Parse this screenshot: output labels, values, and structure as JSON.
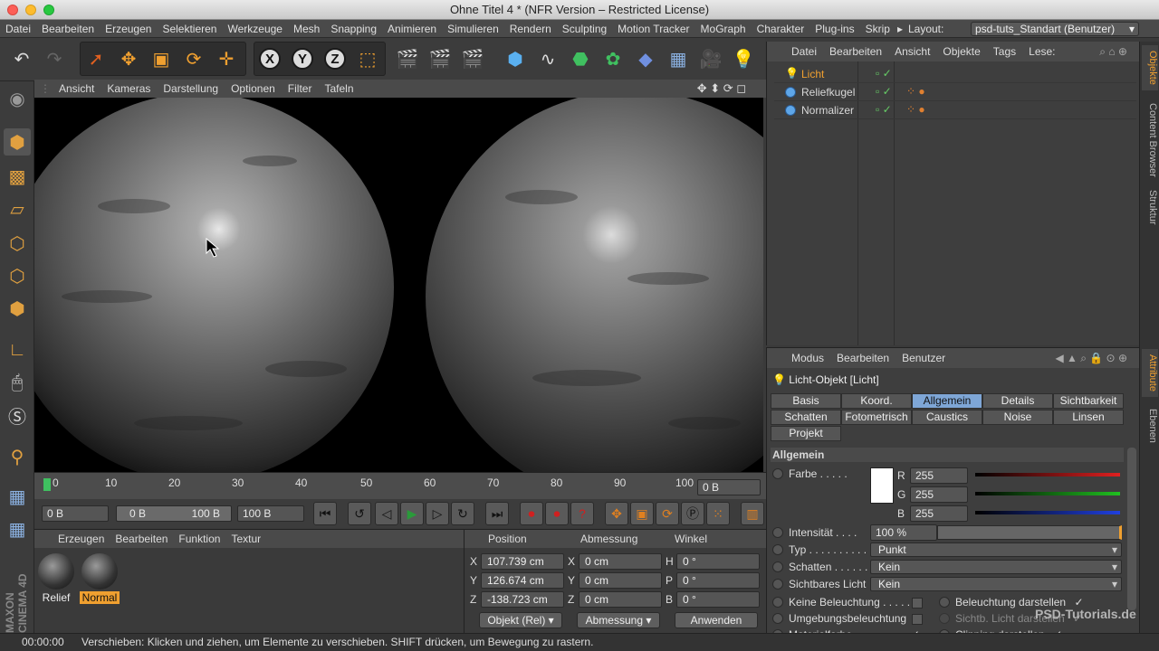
{
  "window": {
    "title": "Ohne Titel 4 * (NFR Version – Restricted License)"
  },
  "menubar": {
    "items": [
      "Datei",
      "Bearbeiten",
      "Erzeugen",
      "Selektieren",
      "Werkzeuge",
      "Mesh",
      "Snapping",
      "Animieren",
      "Simulieren",
      "Rendern",
      "Sculpting",
      "Motion Tracker",
      "MoGraph",
      "Charakter",
      "Plug-ins",
      "Skrip"
    ],
    "layout_label": "Layout:",
    "layout_value": "psd-tuts_Standart (Benutzer)"
  },
  "viewport": {
    "menu": [
      "Ansicht",
      "Kameras",
      "Darstellung",
      "Optionen",
      "Filter",
      "Tafeln"
    ]
  },
  "timeline": {
    "ticks": [
      "0",
      "10",
      "20",
      "30",
      "40",
      "50",
      "60",
      "70",
      "80",
      "90",
      "100"
    ],
    "current_frame_field": "0 B",
    "start_field": "0 B",
    "range_min": "0 B",
    "range_max": "100 B",
    "end_field": "100 B"
  },
  "material_manager": {
    "menu": [
      "Erzeugen",
      "Bearbeiten",
      "Funktion",
      "Textur"
    ],
    "materials": [
      "Relief",
      "Normal"
    ]
  },
  "coordinates": {
    "headers": [
      "Position",
      "Abmessung",
      "Winkel"
    ],
    "position": {
      "x": "107.739 cm",
      "y": "126.674 cm",
      "z": "-138.723 cm"
    },
    "size": {
      "x": "0 cm",
      "y": "0 cm",
      "z": "0 cm"
    },
    "rotation": {
      "h": "0 °",
      "p": "0 °",
      "b": "0 °"
    },
    "axis_labels": {
      "x": "X",
      "y": "Y",
      "z": "Z",
      "h": "H",
      "p": "P",
      "b": "B"
    },
    "mode_dropdown": "Objekt (Rel)",
    "size_dropdown": "Abmessung",
    "apply_button": "Anwenden"
  },
  "object_manager": {
    "menu": [
      "Datei",
      "Bearbeiten",
      "Ansicht",
      "Objekte",
      "Tags",
      "Lese:"
    ],
    "objects": [
      {
        "name": "Licht",
        "color": "#f0a030"
      },
      {
        "name": "Reliefkugel",
        "color": "#dcdcdc"
      },
      {
        "name": "Normalizer",
        "color": "#dcdcdc"
      }
    ]
  },
  "right_tabs": [
    "Objekte",
    "Content Browser",
    "Struktur",
    "Attribute",
    "Ebenen"
  ],
  "attribute_manager": {
    "menu": [
      "Modus",
      "Bearbeiten",
      "Benutzer"
    ],
    "object_title": "Licht-Objekt [Licht]",
    "tabs_row1": [
      "Basis",
      "Koord.",
      "Allgemein",
      "Details",
      "Sichtbarkeit"
    ],
    "tabs_row2": [
      "Schatten",
      "Fotometrisch",
      "Caustics",
      "Noise",
      "Linsen"
    ],
    "tabs_row3": [
      "Projekt"
    ],
    "active_tab": "Allgemein",
    "section": "Allgemein",
    "farbe_label": "Farbe . . . . .",
    "rgb": {
      "r_label": "R",
      "g_label": "G",
      "b_label": "B",
      "r": "255",
      "g": "255",
      "b": "255"
    },
    "intensitaet_label": "Intensität . . . .",
    "intensitaet": "100 %",
    "typ_label": "Typ . . . . . . . . . . .",
    "typ": "Punkt",
    "schatten_label": "Schatten . . . . . .",
    "schatten": "Kein",
    "sichtbares_licht_label": "Sichtbares Licht",
    "sichtbares_licht": "Kein",
    "keine_beleuchtung": "Keine Beleuchtung . . . . .",
    "umgebungsbeleuchtung": "Umgebungsbeleuchtung",
    "materialfarbe": "Materialfarbe . . . . . . . .",
    "beleuchtung_darstellen": "Beleuchtung darstellen",
    "sichtb_licht_darstellen": "Sichtb. Licht darstellen",
    "clipping_darstellen": "Clipping darstellen",
    "check": "✓"
  },
  "status": {
    "time": "00:00:00",
    "message": "Verschieben: Klicken und ziehen, um Elemente zu verschieben. SHIFT drücken, um Bewegung zu rastern."
  },
  "watermark": "PSD-Tutorials.de",
  "brand": "MAXON CINEMA 4D"
}
